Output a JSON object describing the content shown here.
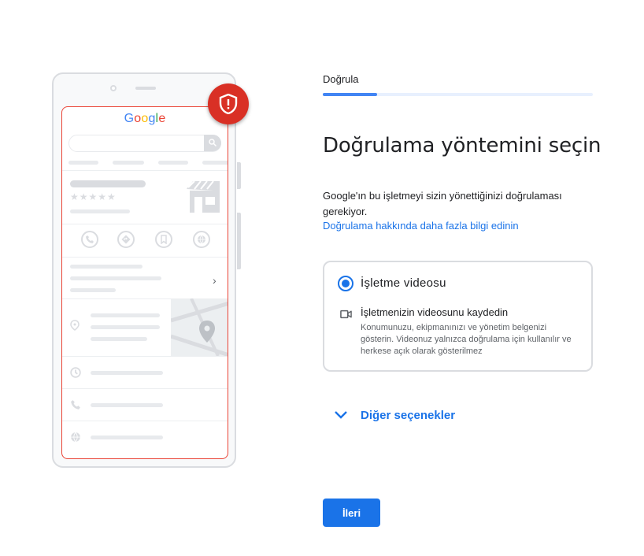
{
  "illustration": {
    "logo_letters": [
      {
        "char": "G",
        "color": "#4285f4"
      },
      {
        "char": "o",
        "color": "#ea4335"
      },
      {
        "char": "o",
        "color": "#fbbc05"
      },
      {
        "char": "g",
        "color": "#4285f4"
      },
      {
        "char": "l",
        "color": "#34a853"
      },
      {
        "char": "e",
        "color": "#ea4335"
      }
    ],
    "rating_stars": "★★★★★",
    "badge_icon": "shield-alert-icon",
    "badge_color": "#d93025"
  },
  "step": {
    "label": "Doğrula",
    "progress_fraction": 0.2
  },
  "main": {
    "title": "Doğrulama yöntemini seçin",
    "description": "Google'ın bu işletmeyi sizin yönettiğinizi doğrulaması gerekiyor.",
    "learn_more_link": "Doğrulama hakkında daha fazla bilgi edinin"
  },
  "option": {
    "title": "İşletme videosu",
    "selected": true,
    "icon": "videocam-icon",
    "subtitle": "İşletmenizin videosunu kaydedin",
    "detail": "Konumunuzu, ekipmanınızı ve yönetim belgenizi gösterin. Videonuz yalnızca doğrulama için kullanılır ve herkese açık olarak gösterilmez"
  },
  "more_options": {
    "label": "Diğer seçenekler",
    "icon": "chevron-down-icon"
  },
  "actions": {
    "next_label": "İleri"
  },
  "colors": {
    "accent": "#1a73e8",
    "progress": "#4285f4",
    "error": "#d93025"
  }
}
